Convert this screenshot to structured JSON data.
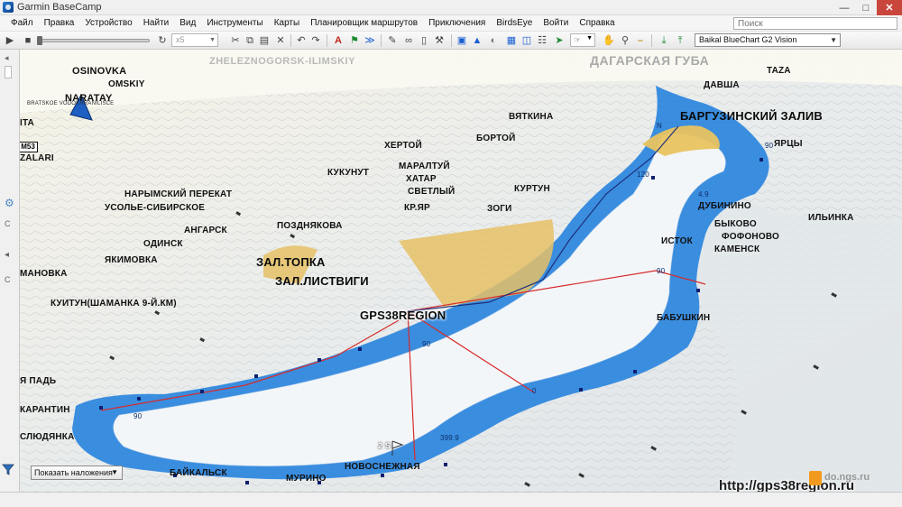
{
  "window": {
    "title": "Garmin BaseCamp"
  },
  "menu": [
    "Файл",
    "Правка",
    "Устройство",
    "Найти",
    "Вид",
    "Инструменты",
    "Карты",
    "Планировщик маршрутов",
    "Приключения",
    "BirdsEye",
    "Войти",
    "Справка"
  ],
  "search": {
    "placeholder": "Поиск"
  },
  "toolbar": {
    "speed": "x5",
    "map_product": "Baikal BlueChart G2 Vision"
  },
  "map": {
    "labels": {
      "zheleznogorsk": "ZHELEZNOGORSK-ILIMSKIY",
      "dagarskaya": "ДАГАРСКАЯ ГУБА",
      "osinovka": "OSINOVKA",
      "omskiy": "OMSKIY",
      "naratay": "NARATAY",
      "bratskoe": "BRATSKOE VODOKHRANILISCE",
      "ita": "ITA",
      "road_sign": "M53",
      "zalari": "ZALARI",
      "taza": "TAZA",
      "davsha": "ДАВША",
      "barguzinsky": "БАРГУЗИНСКИЙ ЗАЛИВ",
      "vyatkina": "ВЯТКИНА",
      "khertoy": "ХЕРТОЙ",
      "bortoy": "БОРТОЙ",
      "yarcy": "ЯРЦЫ",
      "kukunut": "КУКУНУТ",
      "maraltuy": "МАРАЛТУЙ",
      "khatar": "ХАТАР",
      "svetly": "СВЕТЛЫЙ",
      "kurtun": "КУРТУН",
      "narymsky": "НАРЫМСКИЙ ПЕРЕКАТ",
      "usolye": "УСОЛЬЕ-СИБИРСКОЕ",
      "kr_yar": "КР.ЯР",
      "zogi": "ЗОГИ",
      "dubinino": "ДУБИНИНО",
      "ilyinka": "ИЛЬИНКА",
      "pozdnyakova": "ПОЗДНЯКОВА",
      "angarsk": "АНГАРСК",
      "odinsk": "ОДИНСК",
      "bykovo": "БЫКОВО",
      "istok": "ИСТОК",
      "fofonovo": "ФОФОНОВО",
      "kamensk": "КАМЕНСК",
      "yakimovka": "ЯКИМОВКА",
      "zal_topka": "ЗАЛ.ТОПКА",
      "manovka": "МАНОВКА",
      "zal_listvigi": "ЗАЛ.ЛИСТВИГИ",
      "kuytun": "КУИТУН(ШАМАНКА 9-Й.КМ)",
      "gps38region": "GPS38REGION",
      "babushkin": "БАБУШКИН",
      "ya_pad": "Я ПАДЬ",
      "karantin": "КАРАНТИН",
      "slyudyanka": "СЛЮДЯНКА",
      "baykalsk": "БАЙКАЛЬСК",
      "murino": "МУРИНО",
      "novosnezhnaya": "НОВОСНЕЖНАЯ",
      "wp_2s": "2 S",
      "d_90a": "90",
      "d_90b": "90",
      "d_90c": "90",
      "d_90d": "90",
      "d_0": "0",
      "d_3999": "399.9",
      "d_120": "120",
      "d_49": "4.9",
      "d_n": "N"
    },
    "watermark": "http://gps38region.ru",
    "ngs": "do.ngs.ru",
    "overlay_button": "Показать наложения"
  }
}
